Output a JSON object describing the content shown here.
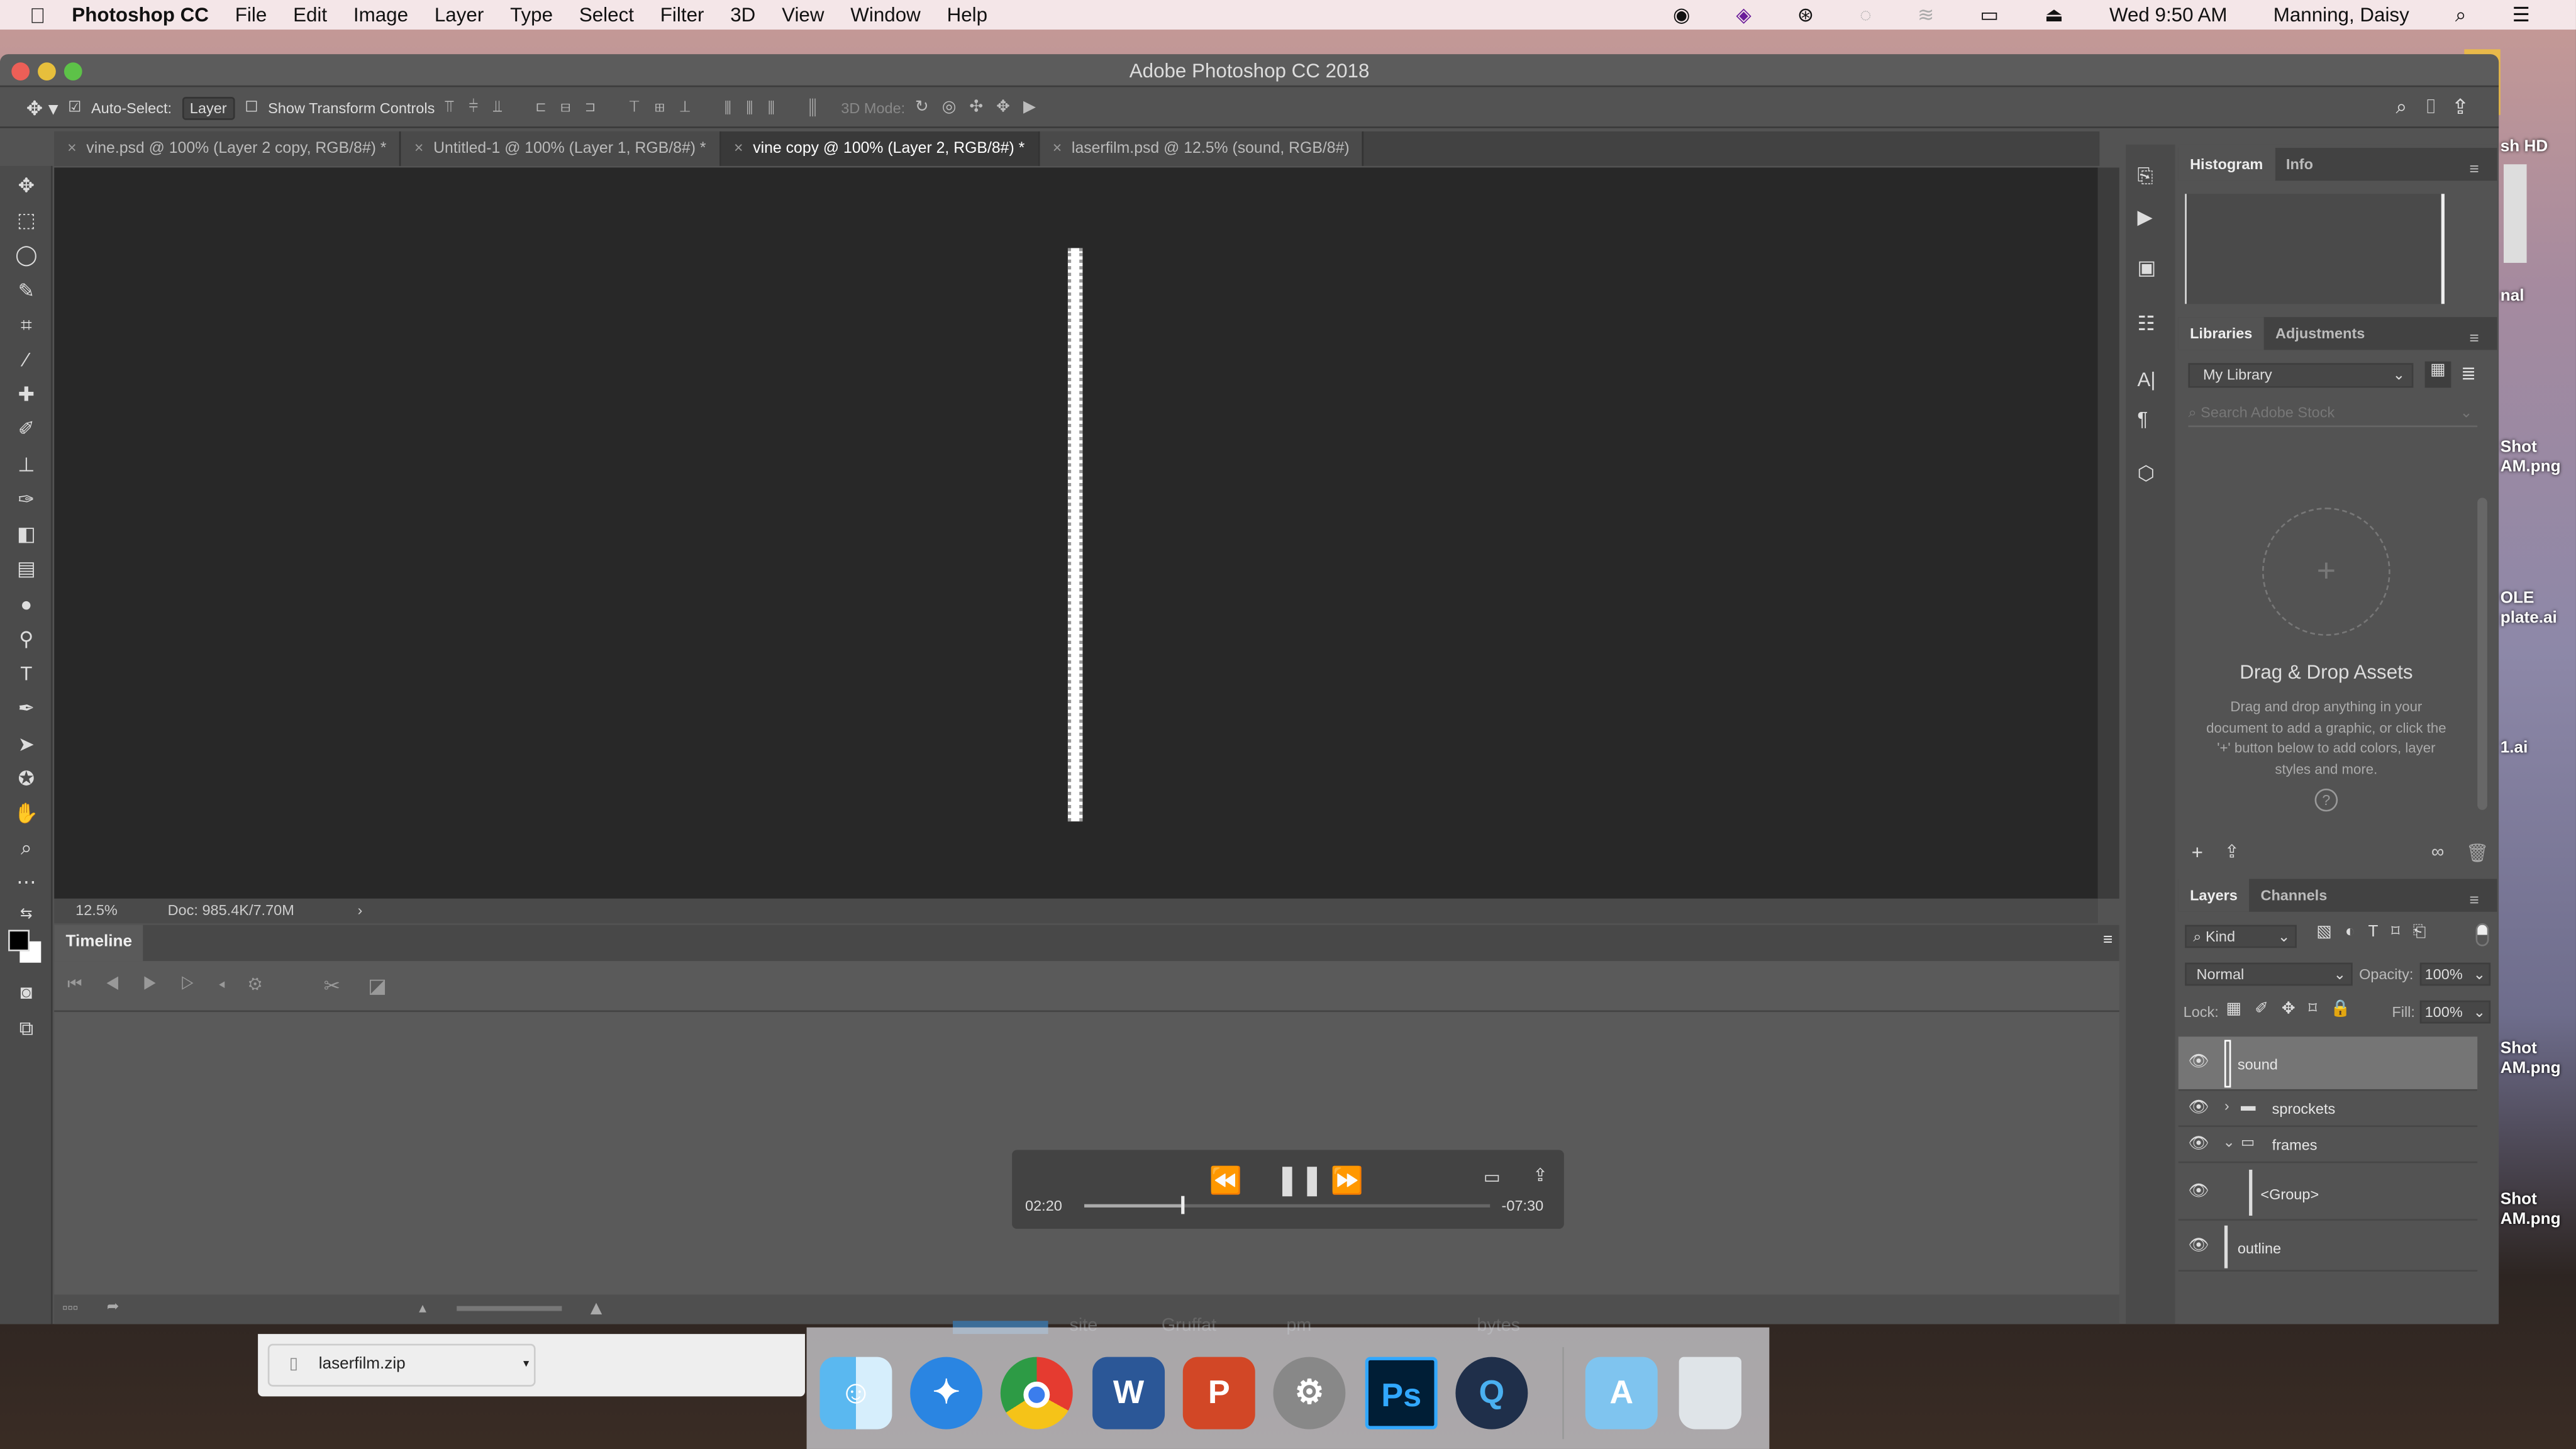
{
  "menubar": {
    "app": "Photoshop CC",
    "items": [
      "File",
      "Edit",
      "Image",
      "Layer",
      "Type",
      "Select",
      "Filter",
      "3D",
      "View",
      "Window",
      "Help"
    ],
    "clock": "Wed 9:50 AM",
    "user": "Manning, Daisy"
  },
  "window": {
    "title": "Adobe Photoshop CC 2018"
  },
  "options": {
    "auto_select": "Auto-Select:",
    "auto_select_value": "Layer",
    "show_transform": "Show Transform Controls",
    "mode_3d": "3D Mode:"
  },
  "tabs": [
    {
      "label": "vine.psd @ 100% (Layer 2 copy, RGB/8#) *"
    },
    {
      "label": "Untitled-1 @ 100% (Layer 1, RGB/8#) *"
    },
    {
      "label": "vine copy @ 100% (Layer 2, RGB/8#) *",
      "active": true
    },
    {
      "label": "laserfilm.psd @ 12.5% (sound, RGB/8#)"
    }
  ],
  "status": {
    "zoom": "12.5%",
    "doc": "Doc: 985.4K/7.70M"
  },
  "timeline": {
    "title": "Timeline"
  },
  "histogram": {
    "tabs": [
      "Histogram",
      "Info"
    ]
  },
  "libraries": {
    "tabs": [
      "Libraries",
      "Adjustments"
    ],
    "library": "My Library",
    "search_placeholder": "Search Adobe Stock",
    "empty_title": "Drag & Drop Assets",
    "empty_text": "Drag and drop anything in your document to add a graphic, or click the '+' button below to add colors, layer styles and more."
  },
  "layers": {
    "tabs": [
      "Layers",
      "Channels"
    ],
    "filter": "Kind",
    "blend": "Normal",
    "opacity_label": "Opacity:",
    "opacity": "100%",
    "lock_label": "Lock:",
    "fill_label": "Fill:",
    "fill": "100%",
    "items": [
      {
        "name": "sound",
        "selected": true
      },
      {
        "name": "sprockets",
        "type": "group",
        "expanded": false
      },
      {
        "name": "frames",
        "type": "group",
        "expanded": true
      },
      {
        "name": "<Group>",
        "indent": true
      },
      {
        "name": "outline"
      }
    ]
  },
  "player": {
    "elapsed": "02:20",
    "remaining": "-07:30",
    "progress": 0.24
  },
  "download": {
    "file": "laserfilm.zip"
  },
  "background_text": [
    "site",
    "Gruffat",
    "pm",
    "bytes"
  ],
  "desktop": {
    "labels": [
      "sh HD",
      "nal",
      "Shot\nAM.png",
      "OLE\nplate.ai",
      "1.ai",
      "Shot\nAM.png",
      "Shot\nAM.png"
    ]
  },
  "dock": {
    "apps": [
      "Finder",
      "Safari",
      "Chrome",
      "Word",
      "PowerPoint",
      "System Preferences",
      "Photoshop",
      "QuickTime",
      "Applications",
      "Trash"
    ]
  },
  "colors": {
    "accent": "#31a8ff",
    "canvas": "#282828",
    "panel": "#535353"
  }
}
